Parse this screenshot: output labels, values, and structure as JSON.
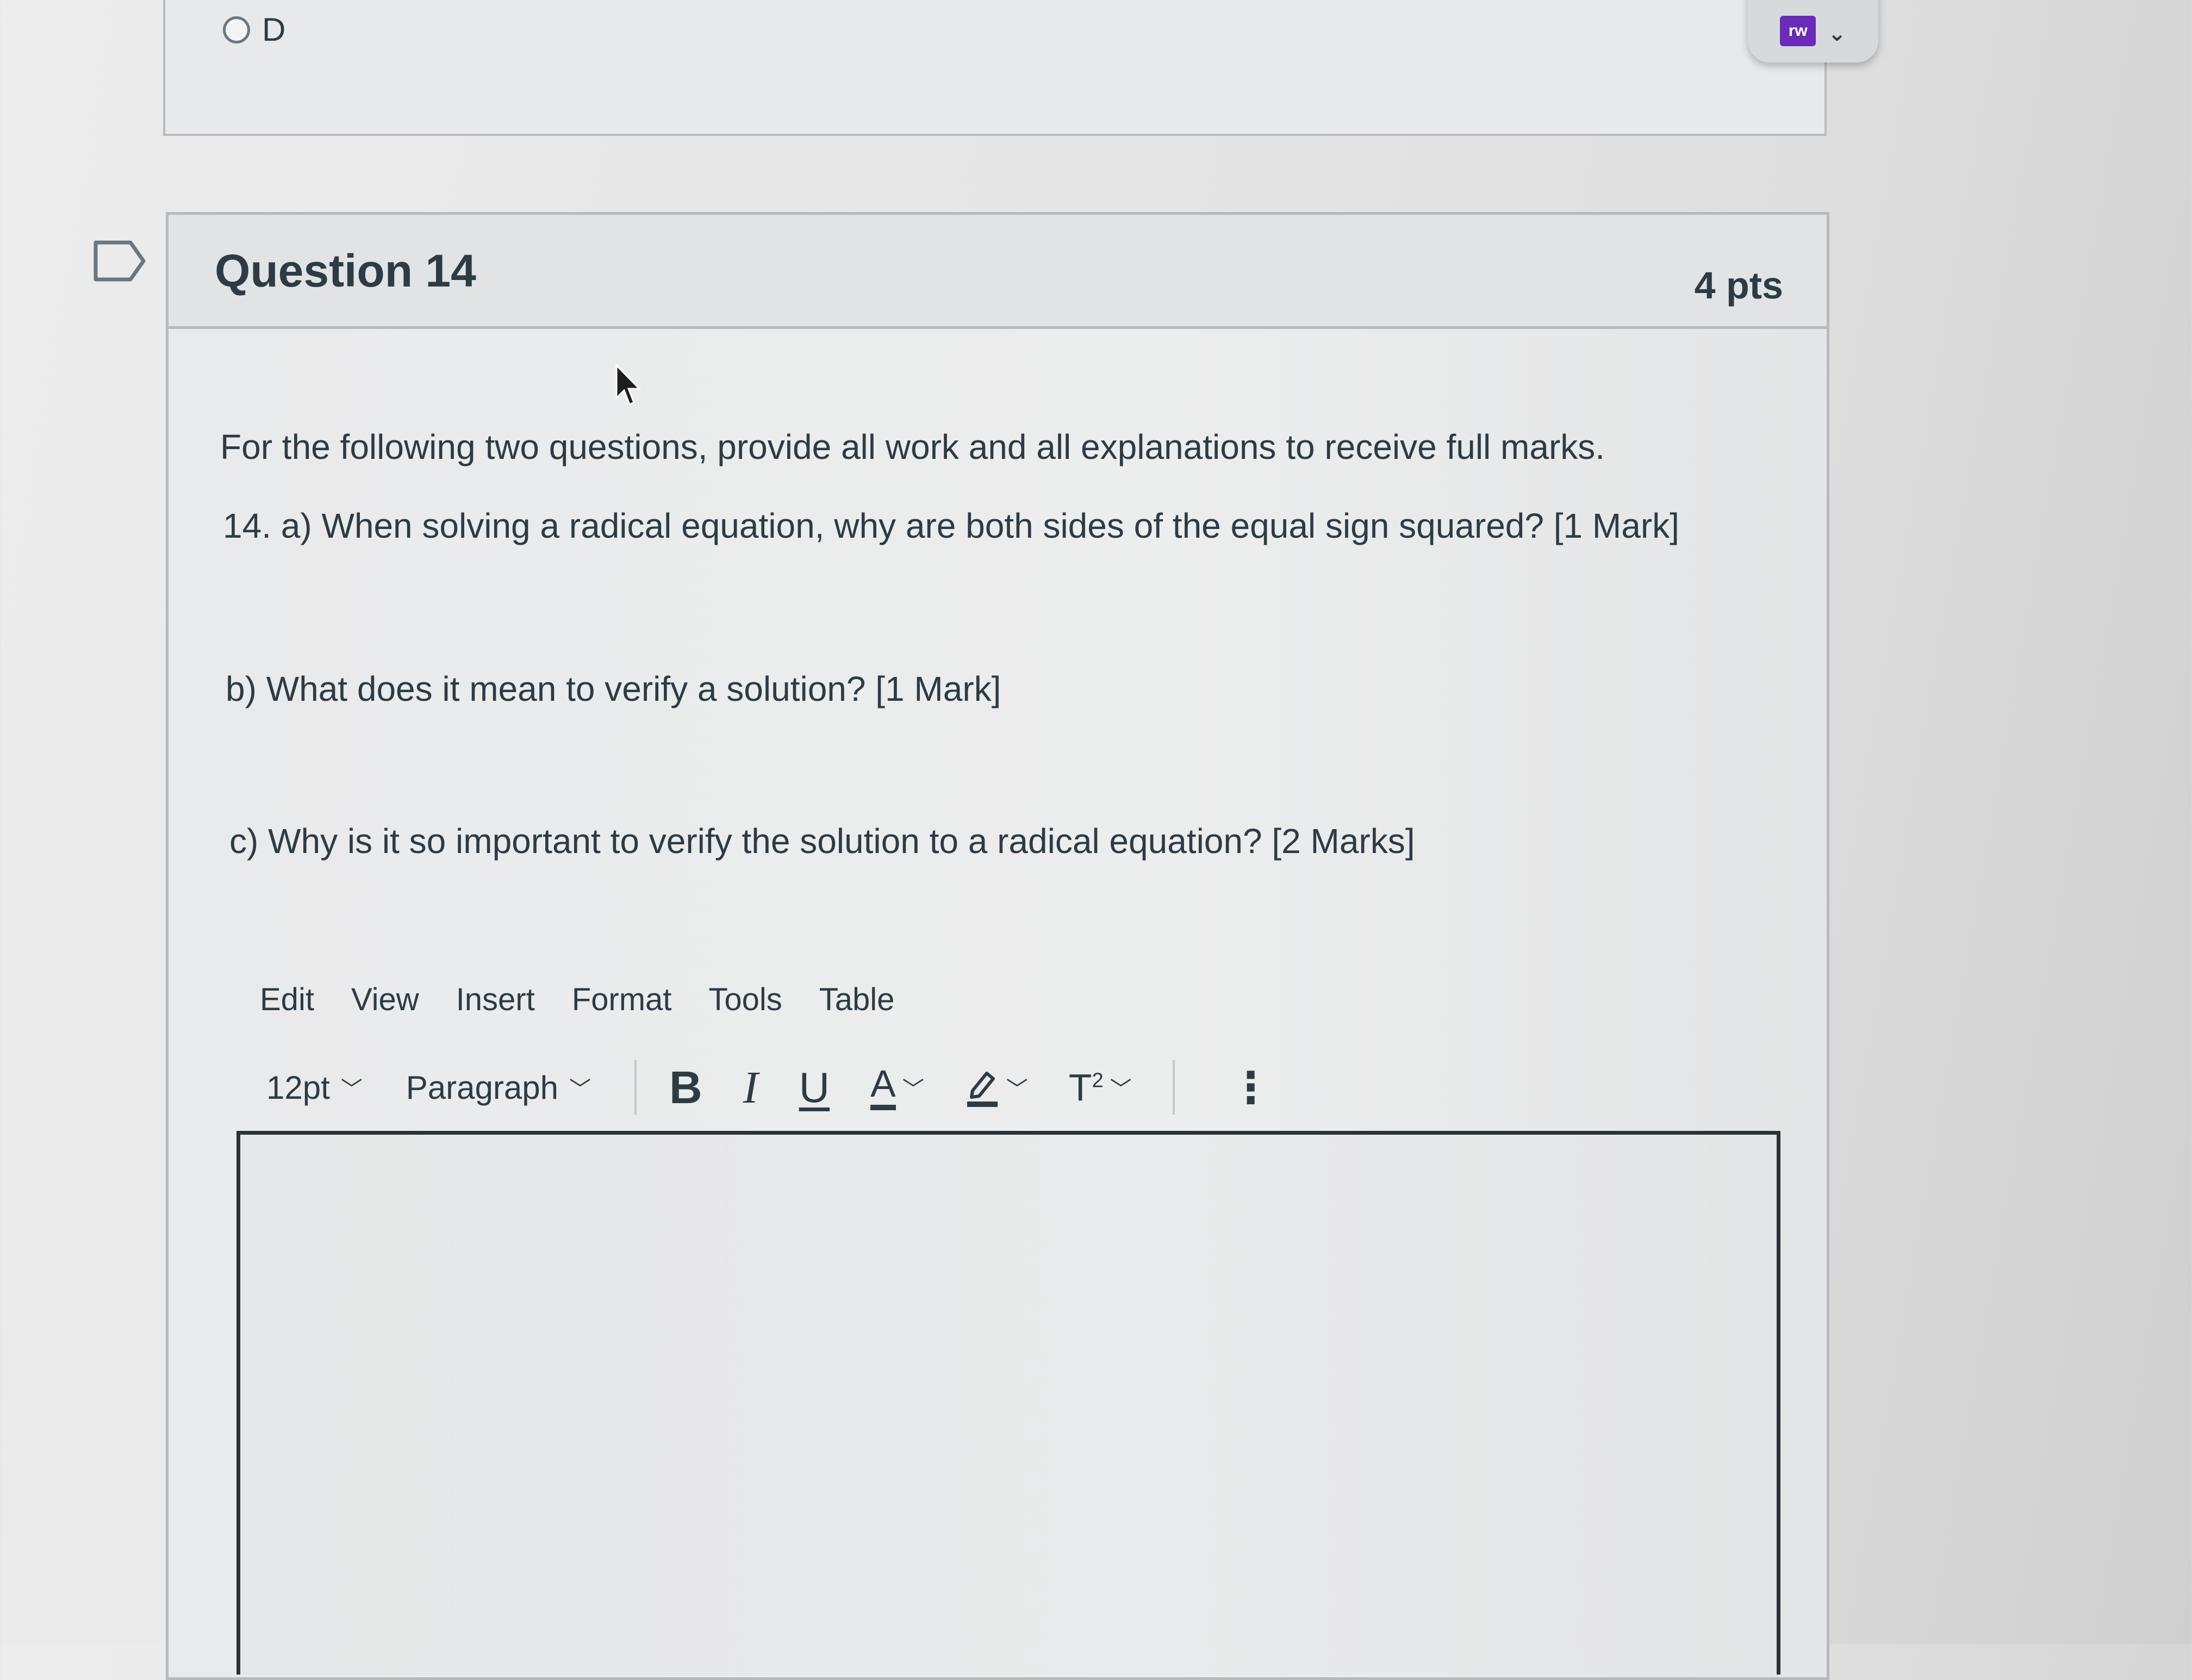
{
  "previous_question": {
    "option_label": "D"
  },
  "extension": {
    "logo_text": "rw"
  },
  "question": {
    "title": "Question 14",
    "points": "4 pts",
    "instructions": "For the following two questions, provide all work and all explanations to receive full marks.",
    "part_a": "14. a) When solving a radical equation, why are both sides of the equal sign squared? [1 Mark]",
    "part_b": "b) What does it mean to verify a solution? [1 Mark]",
    "part_c": "c) Why is it so important to verify the solution to a radical equation? [2 Marks]"
  },
  "editor": {
    "menu": [
      "Edit",
      "View",
      "Insert",
      "Format",
      "Tools",
      "Table"
    ],
    "font_size": "12pt",
    "block_format": "Paragraph",
    "bold_label": "B",
    "italic_label": "I",
    "underline_label": "U",
    "text_color_label": "A",
    "superscript_label": "T",
    "superscript_exp": "2",
    "more_label": "⋮",
    "content": ""
  },
  "colors": {
    "text": "#2d3b45",
    "extension_purple": "#6a2bb8",
    "card_border": "#b7babd"
  }
}
